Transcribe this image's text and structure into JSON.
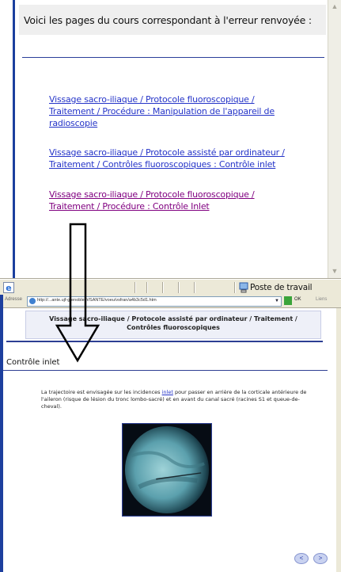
{
  "top_window": {
    "heading": "Voici les pages du cours correspondant à l'erreur renvoyée :",
    "links": [
      {
        "line1": "Vissage sacro-iliaque / Protocole fluoroscopique /",
        "line2": "Traitement / Procédure : Manipulation de l'appareil de",
        "line3": "radioscopie",
        "visited": false
      },
      {
        "line1": "Vissage sacro-iliaque / Protocole assisté par ordinateur /",
        "line2": "Traitement / Contrôles fluoroscopiques : Contrôle inlet",
        "visited": false
      },
      {
        "line1": "Vissage sacro-iliaque / Protocole fluoroscopique /",
        "line2": "Traitement / Procédure : Contrôle Inlet",
        "visited": true
      }
    ],
    "status_zone": "Poste de travail",
    "colors": {
      "link": "#2534c8",
      "visited": "#800080",
      "border": "#1b3f9e"
    }
  },
  "bottom_window": {
    "address_label": "Adresse",
    "address": "http://...ante.ujf-grenoble.fr/SANTE/voeu/vsfran/a4b3c5d1.htm",
    "go_label": "OK",
    "links_label": "Liens",
    "breadcrumb_line1": "Vissage sacro-iliaque / Protocole assisté par ordinateur / Traitement /",
    "breadcrumb_line2": "Contrôles fluoroscopiques",
    "section_title": "Contrôle inlet",
    "body_part1": "La trajectoire est envisagée sur les incidences ",
    "body_link": "inlet",
    "body_part2": " pour passer en arrière de la corticale antérieure de l'aileron (risque de lésion du tronc lombo-sacré) et en avant du canal sacré (racines S1 et queue-de-cheval).",
    "nav_prev": "<",
    "nav_next": ">"
  },
  "icons": {
    "ie": "internet-explorer-icon",
    "zone": "my-computer-icon",
    "arrow": "down-arrow-annotation"
  }
}
